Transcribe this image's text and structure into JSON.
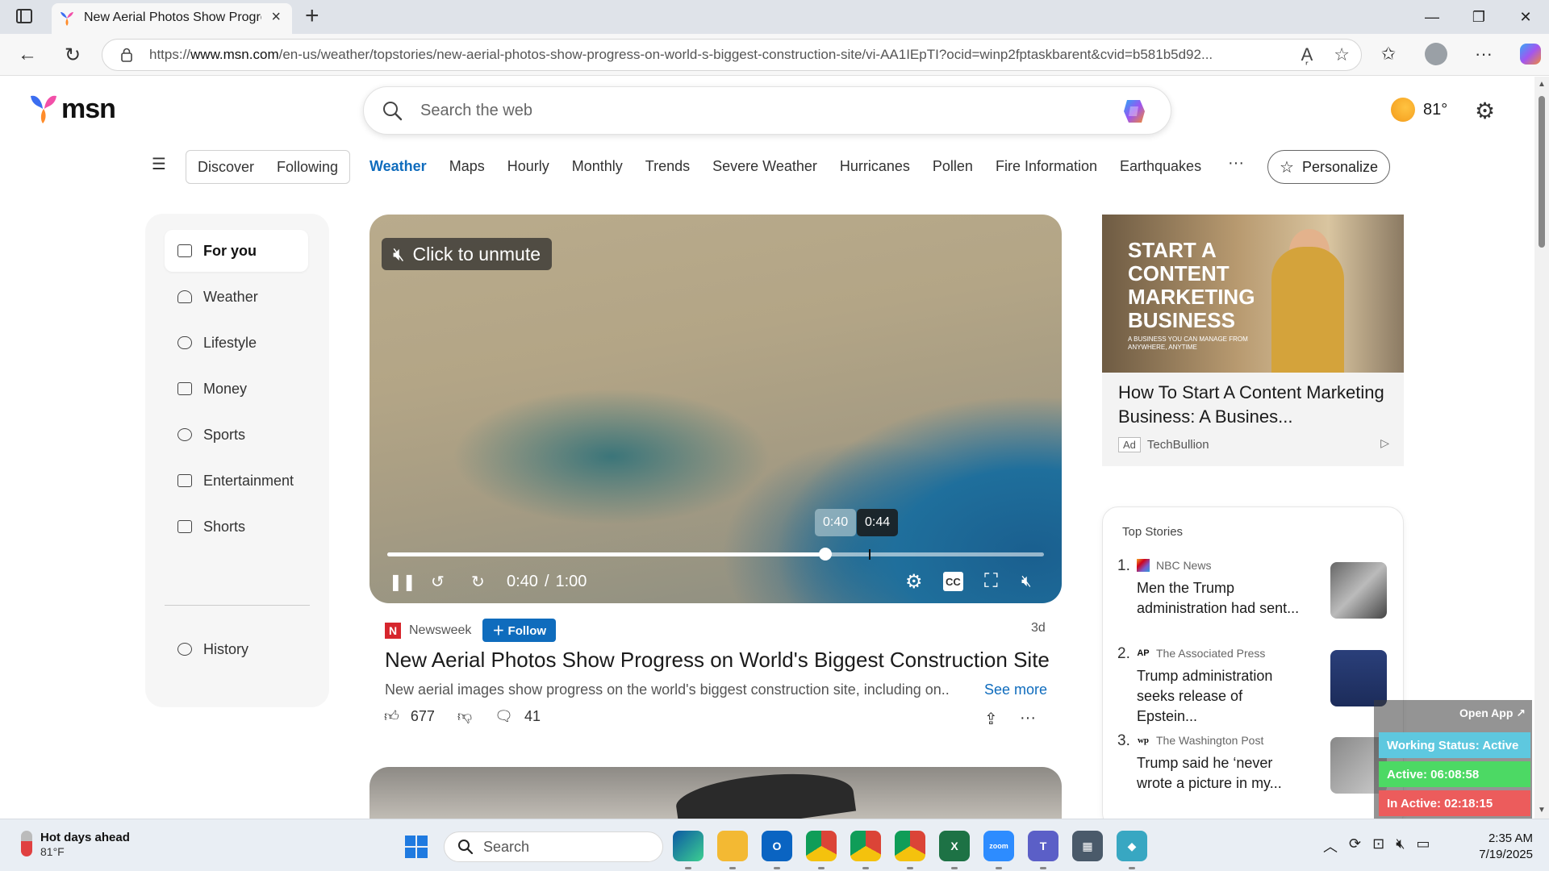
{
  "browser": {
    "tab_title": "New Aerial Photos Show Progress on World's Biggest Construction Site",
    "url_prefix": "https://",
    "url_domain": "www.msn.com",
    "url_path": "/en-us/weather/topstories/new-aerial-photos-show-progress-on-world-s-biggest-construction-site/vi-AA1IEpTI?ocid=winp2fptaskbarent&cvid=b581b5d92..."
  },
  "header": {
    "logo_text": "msn",
    "search_placeholder": "Search the web",
    "temperature": "81°"
  },
  "topnav": {
    "pill_items": [
      "Discover",
      "Following"
    ],
    "links": [
      "Weather",
      "Maps",
      "Hourly",
      "Monthly",
      "Trends",
      "Severe Weather",
      "Hurricanes",
      "Pollen",
      "Fire Information",
      "Earthquakes"
    ],
    "active_link": "Weather",
    "more": "···",
    "personalize": "Personalize"
  },
  "sidebar": {
    "items": [
      {
        "label": "For you",
        "icon": "play-square-icon"
      },
      {
        "label": "Weather",
        "icon": "weather-icon"
      },
      {
        "label": "Lifestyle",
        "icon": "lifestyle-icon"
      },
      {
        "label": "Money",
        "icon": "money-icon"
      },
      {
        "label": "Sports",
        "icon": "sports-icon"
      },
      {
        "label": "Entertainment",
        "icon": "entertainment-icon"
      },
      {
        "label": "Shorts",
        "icon": "shorts-icon"
      }
    ],
    "history": "History"
  },
  "video": {
    "unmute_label": "Click to unmute",
    "current_time": "0:40",
    "separator": "/",
    "duration": "1:00",
    "hover_time": "0:44",
    "progress": 0.6667,
    "hover_progress": 0.7333,
    "cc_label": "CC"
  },
  "article": {
    "source": "Newsweek",
    "source_logo": "N",
    "follow_label": "Follow",
    "age": "3d",
    "headline": "New Aerial Photos Show Progress on World's Biggest Construction Site",
    "summary": "New aerial images show progress on the world's biggest construction site, including on...",
    "see_more": "See more",
    "likes": "677",
    "comments": "41"
  },
  "ad": {
    "image_text": "START A CONTENT MARKETING BUSINESS",
    "image_subtext": "A BUSINESS YOU CAN MANAGE FROM ANYWHERE, ANYTIME",
    "title": "How To Start A Content Marketing Business: A Busines...",
    "badge": "Ad",
    "advertiser": "TechBullion"
  },
  "top_stories": {
    "title": "Top Stories",
    "items": [
      {
        "num": "1.",
        "source": "NBC News",
        "title": "Men the Trump administration had sent..."
      },
      {
        "num": "2.",
        "source": "The Associated Press",
        "title": "Trump administration seeks release of Epstein..."
      },
      {
        "num": "3.",
        "source": "The Washington Post",
        "title": "Trump said he ‘never wrote a picture in my..."
      }
    ]
  },
  "widget": {
    "open_app": "Open App ↗",
    "status": "Working Status: Active",
    "active": "Active: 06:08:58",
    "inactive": "In Active: 02:18:15",
    "colors": {
      "status": "#5ec8df",
      "active": "#4cd964",
      "inactive": "#ec5c5c"
    }
  },
  "taskbar": {
    "weather_title": "Hot days ahead",
    "weather_temp": "81°F",
    "search_label": "Search",
    "time": "2:35 AM",
    "date": "7/19/2025"
  }
}
